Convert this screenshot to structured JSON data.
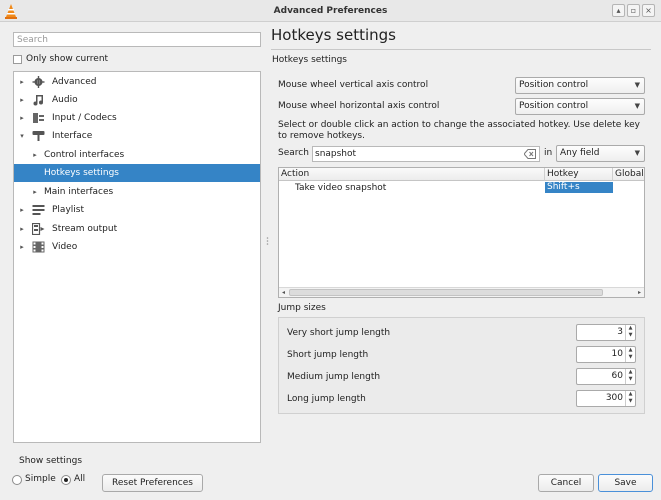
{
  "window": {
    "title": "Advanced Preferences"
  },
  "left": {
    "search_placeholder": "Search",
    "only_show_current": "Only show current",
    "tree": [
      {
        "label": "Advanced",
        "icon": "gear-icon",
        "arrow": "▸"
      },
      {
        "label": "Audio",
        "icon": "audio-icon",
        "arrow": "▸"
      },
      {
        "label": "Input / Codecs",
        "icon": "codec-icon",
        "arrow": "▸"
      },
      {
        "label": "Interface",
        "icon": "interface-icon",
        "arrow": "▾"
      },
      {
        "label": "Control interfaces",
        "arrow": "▸"
      },
      {
        "label": "Hotkeys settings",
        "selected": true
      },
      {
        "label": "Main interfaces",
        "arrow": "▸"
      },
      {
        "label": "Playlist",
        "icon": "playlist-icon",
        "arrow": "▸"
      },
      {
        "label": "Stream output",
        "icon": "stream-icon",
        "arrow": "▸"
      },
      {
        "label": "Video",
        "icon": "video-icon",
        "arrow": "▸"
      }
    ],
    "show_settings": "Show settings",
    "simple": "Simple",
    "all": "All",
    "reset": "Reset Preferences"
  },
  "panel": {
    "title": "Hotkeys settings",
    "subtitle": "Hotkeys settings",
    "vertical_label": "Mouse wheel vertical axis control",
    "vertical_value": "Position control",
    "horizontal_label": "Mouse wheel horizontal axis control",
    "horizontal_value": "Position control",
    "info": "Select or double click an action to change the associated hotkey. Use delete key to remove hotkeys.",
    "search_label": "Search",
    "search_value": "snapshot",
    "in_label": "in",
    "field_value": "Any field",
    "table": {
      "headers": [
        "Action",
        "Hotkey",
        "Global"
      ],
      "rows": [
        {
          "action": "Take video snapshot",
          "hotkey": "Shift+s",
          "global": ""
        }
      ]
    },
    "jump_title": "Jump sizes",
    "jumps": [
      {
        "label": "Very short jump length",
        "value": "3"
      },
      {
        "label": "Short jump length",
        "value": "10"
      },
      {
        "label": "Medium jump length",
        "value": "60"
      },
      {
        "label": "Long jump length",
        "value": "300"
      }
    ]
  },
  "buttons": {
    "cancel": "Cancel",
    "save": "Save"
  },
  "colors": {
    "selection": "#3584c6"
  }
}
